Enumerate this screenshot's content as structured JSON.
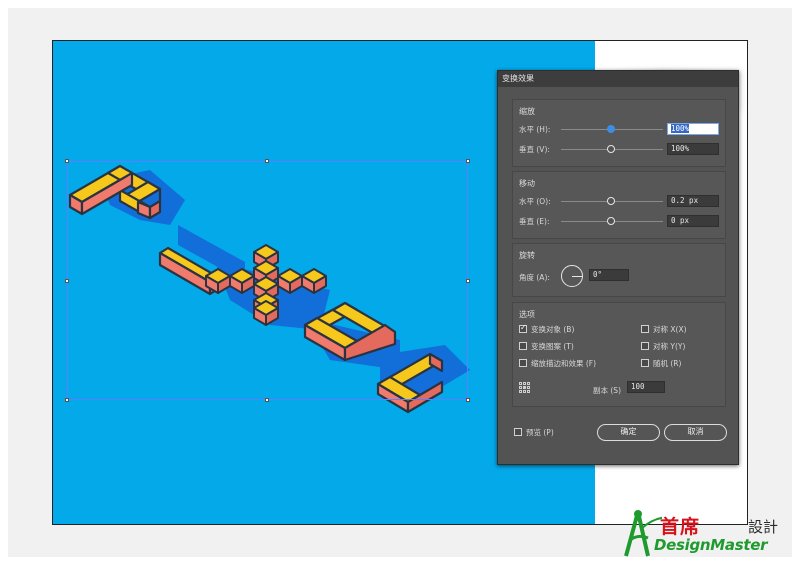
{
  "dialog": {
    "title": "变换效果",
    "scale": {
      "title": "缩放",
      "horizontal_label": "水平 (H):",
      "horizontal_value": "100%",
      "vertical_label": "垂直 (V):",
      "vertical_value": "100%"
    },
    "move": {
      "title": "移动",
      "horizontal_label": "水平 (O):",
      "horizontal_value": "0.2 px",
      "vertical_label": "垂直 (E):",
      "vertical_value": "0 px"
    },
    "rotate": {
      "title": "旋转",
      "angle_label": "角度 (A):",
      "angle_value": "0°"
    },
    "options": {
      "title": "选项",
      "transform_objects": "变换对象 (B)",
      "transform_patterns": "变换图案 (T)",
      "scale_strokes": "缩放描边和效果 (F)",
      "reflect_x": "对称 X(X)",
      "reflect_y": "对称 Y(Y)",
      "random": "随机 (R)"
    },
    "copies_label": "副本 (S)",
    "copies_value": "100",
    "preview_label": "预览 (P)",
    "ok_label": "确定",
    "cancel_label": "取消"
  },
  "logo": {
    "chinese": "首席",
    "chinese_suffix": "設計",
    "english": "DesignMaster"
  },
  "colors": {
    "canvas": "#04a9ea",
    "dialog_bg": "#535353",
    "letter_top": "#f6c81c",
    "letter_side": "#f07a6c",
    "active_slider": "#3c8ee6"
  }
}
